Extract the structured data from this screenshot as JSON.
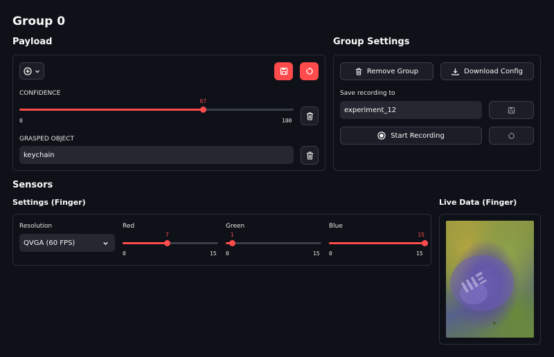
{
  "group_title": "Group 0",
  "payload": {
    "heading": "Payload",
    "confidence": {
      "label": "CONFIDENCE",
      "value": 67,
      "min": 0,
      "max": 100,
      "value_text": "67",
      "min_text": "0",
      "max_text": "100"
    },
    "grasped": {
      "label": "GRASPED OBJECT",
      "value": "keychain"
    }
  },
  "group_settings": {
    "heading": "Group Settings",
    "remove_label": "Remove Group",
    "download_label": "Download Config",
    "save_label": "Save recording to",
    "save_value": "experiment_12",
    "start_label": "Start Recording"
  },
  "sensors": {
    "heading": "Sensors",
    "settings_heading": "Settings (Finger)",
    "live_heading": "Live Data (Finger)",
    "resolution": {
      "label": "Resolution",
      "value": "QVGA (60 FPS)"
    },
    "sliders": [
      {
        "label": "Red",
        "value": 7,
        "min": 0,
        "max": 15,
        "value_text": "7",
        "min_text": "0",
        "max_text": "15"
      },
      {
        "label": "Green",
        "value": 1,
        "min": 0,
        "max": 15,
        "value_text": "1",
        "min_text": "0",
        "max_text": "15"
      },
      {
        "label": "Blue",
        "value": 15,
        "min": 0,
        "max": 15,
        "value_text": "15",
        "min_text": "0",
        "max_text": "15"
      }
    ]
  },
  "colors": {
    "accent": "#ff4b4b",
    "background": "#0e1117",
    "input": "#262730"
  }
}
